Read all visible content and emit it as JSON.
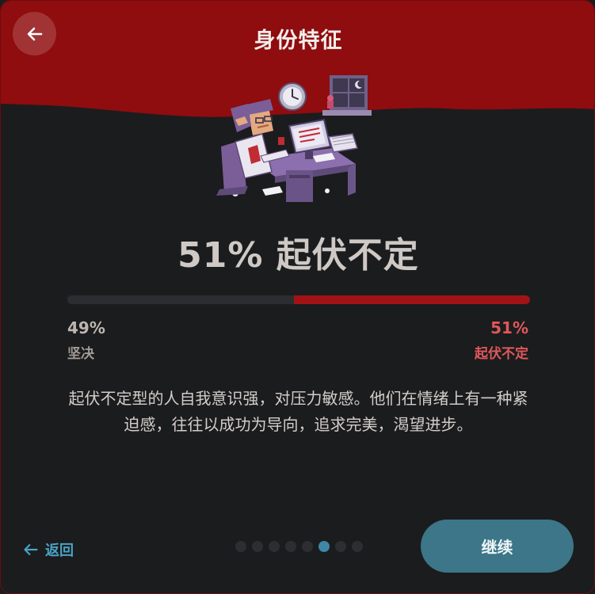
{
  "header": {
    "title": "身份特征",
    "back_icon": "arrow-left-icon"
  },
  "result": {
    "heading": "51% 起伏不定",
    "trait_fraction": 0.51
  },
  "scale": {
    "left": {
      "percent": "49%",
      "label": "坚决"
    },
    "right": {
      "percent": "51%",
      "label": "起伏不定"
    }
  },
  "description": "起伏不定型的人自我意识强，对压力敏感。他们在情绪上有一种紧迫感，往往以成功为导向，追求完美，渴望进步。",
  "footer": {
    "back_label": "返回",
    "back_icon": "arrow-left-icon",
    "continue_label": "继续",
    "page_count": 8,
    "active_page": 6
  },
  "colors": {
    "header_red": "#8f0c0f",
    "bar_fill": "#a31316",
    "accent_red": "#e0585a",
    "link_blue": "#4aa3c6",
    "button_teal": "#3c7688",
    "background": "#1b1c1e"
  }
}
